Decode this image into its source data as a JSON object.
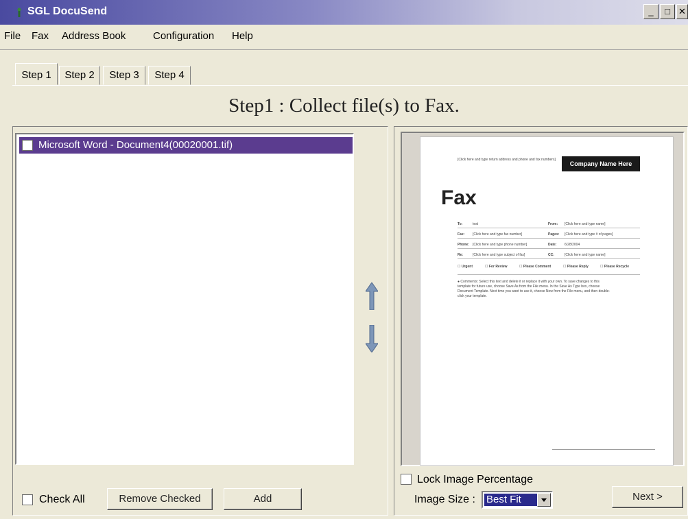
{
  "window": {
    "title": "SGL DocuSend",
    "controls": {
      "minimize": "_",
      "maximize": "□",
      "close": "✕"
    }
  },
  "menu": [
    "File",
    "Fax",
    "Address Book",
    "Configuration",
    "Help"
  ],
  "tabs": [
    "Step 1",
    "Step 2",
    "Step 3",
    "Step 4"
  ],
  "heading": "Step1 : Collect file(s) to Fax.",
  "file_list": {
    "items": [
      {
        "label": "Microsoft Word - Document4(00020001.tif)",
        "checked": false,
        "selected": true
      }
    ]
  },
  "move_controls": {
    "up_icon": "arrow-up-icon",
    "down_icon": "arrow-down-icon"
  },
  "left_footer": {
    "check_all_label": "Check All",
    "remove_checked_label": "Remove Checked",
    "add_label": "Add"
  },
  "preview": {
    "fax_title": "Fax",
    "company_name": "Company Name Here",
    "return_address": "[Click here and type return address and phone and fax numbers]",
    "fields_left": [
      {
        "label": "To:",
        "value": "test"
      },
      {
        "label": "Fax:",
        "value": "[Click here and type fax number]"
      },
      {
        "label": "Phone:",
        "value": "[Click here and type phone number]"
      },
      {
        "label": "Re:",
        "value": "[Click here and type subject of fax]"
      }
    ],
    "fields_right": [
      {
        "label": "From:",
        "value": "[Click here and type name]"
      },
      {
        "label": "Pages:",
        "value": "[Click here and type # of pages]"
      },
      {
        "label": "Date:",
        "value": "6/28/2004"
      },
      {
        "label": "CC:",
        "value": "[Click here and type name]"
      }
    ],
    "checkboxes": [
      "☐ Urgent",
      "☐ For Review",
      "☐ Please Comment",
      "☐ Please Reply",
      "☐ Please Recycle"
    ],
    "comments_line1": "● Comments: Select this text and delete it or replace it with your own. To save changes to this",
    "comments_line2": "template for future use, choose Save As from the File menu. In the Save As Type box, choose",
    "comments_line3": "Document Template. Next time you want to use it, choose New from the File menu, and then double-",
    "comments_line4": "click your template."
  },
  "right_footer": {
    "lock_label": "Lock Image Percentage",
    "image_size_label": "Image Size :",
    "image_size_value": "Best Fit",
    "next_label": "Next >"
  },
  "colors": {
    "selection": "#5b3c8f",
    "arrow": "#7d96b8",
    "title_gradient_start": "#4a4aa0"
  }
}
